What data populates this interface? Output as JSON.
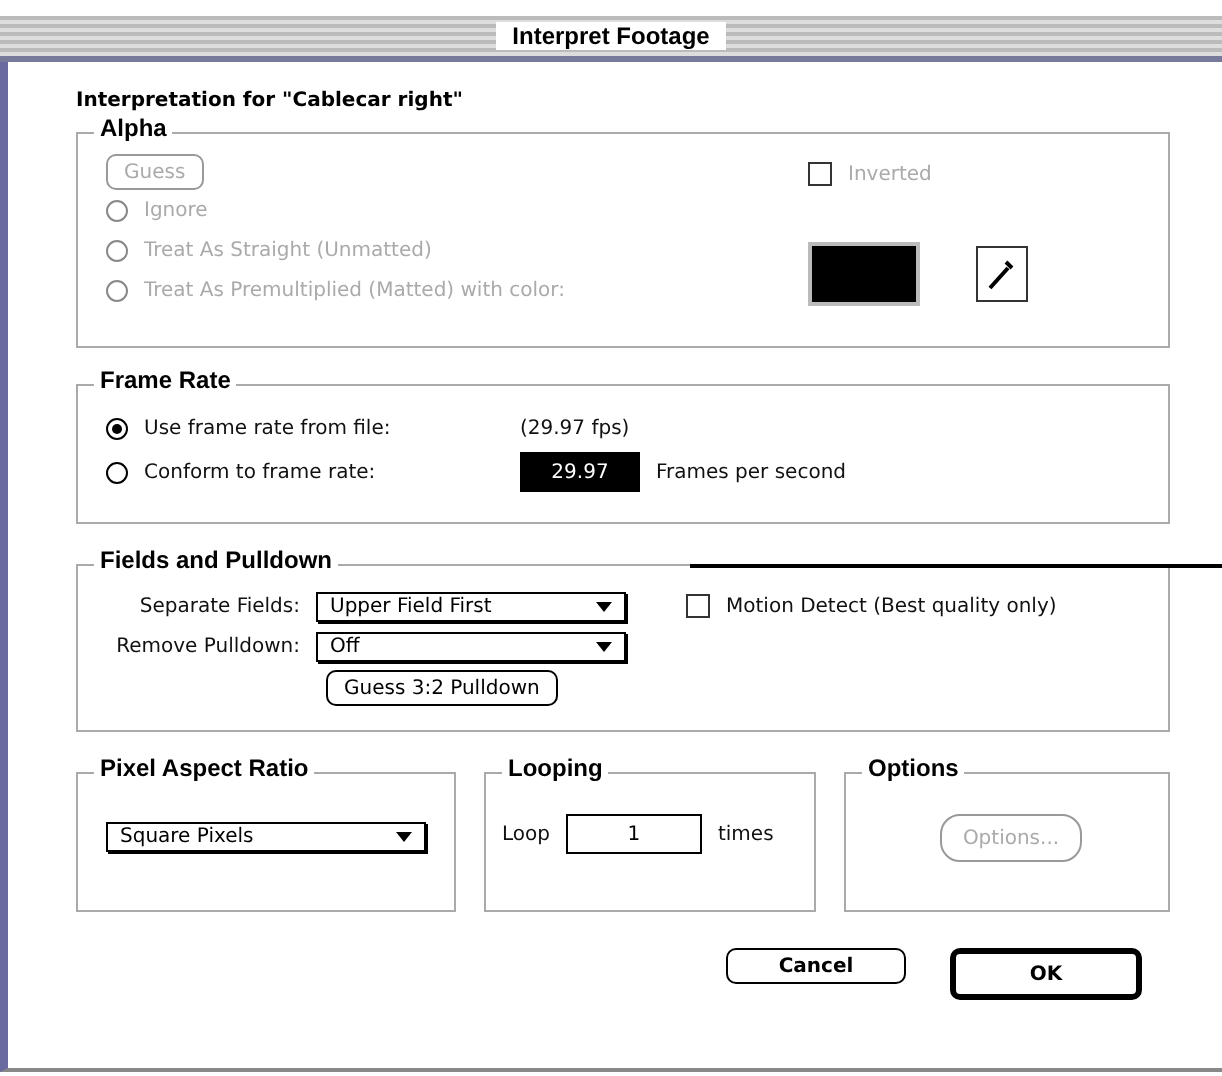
{
  "window": {
    "title": "Interpret Footage"
  },
  "heading": "Interpretation for \"Cablecar right\"",
  "alpha": {
    "title": "Alpha",
    "disabled": true,
    "guess_button": "Guess",
    "invert": {
      "label": "Inverted",
      "checked": false
    },
    "options": [
      {
        "label": "Ignore",
        "selected": false
      },
      {
        "label": "Treat As Straight (Unmatted)",
        "selected": false
      },
      {
        "label": "Treat As Premultiplied (Matted) with color:",
        "selected": false
      }
    ]
  },
  "frame_rate": {
    "title": "Frame Rate",
    "options": [
      {
        "label": "Use frame rate from file:",
        "selected": true,
        "note": "(29.97 fps)"
      },
      {
        "label": "Conform to frame rate:",
        "selected": false,
        "value": "29.97",
        "unit": "Frames per second"
      }
    ]
  },
  "fields": {
    "title": "Fields and Pulldown",
    "separate_label": "Separate Fields:",
    "separate_value": "Upper Field First",
    "remove_label": "Remove Pulldown:",
    "remove_value": "Off",
    "guess_button": "Guess 3:2 Pulldown",
    "motion_detect": {
      "label": "Motion Detect (Best quality only)",
      "checked": false
    }
  },
  "pixel_aspect": {
    "title": "Pixel Aspect Ratio",
    "value": "Square Pixels"
  },
  "looping": {
    "title": "Looping",
    "label": "Loop",
    "value": "1",
    "unit": "times"
  },
  "options": {
    "title": "Options",
    "button": "Options...",
    "disabled": true
  },
  "buttons": [
    {
      "label": "Cancel",
      "default": false
    },
    {
      "label": "OK",
      "default": true
    }
  ]
}
